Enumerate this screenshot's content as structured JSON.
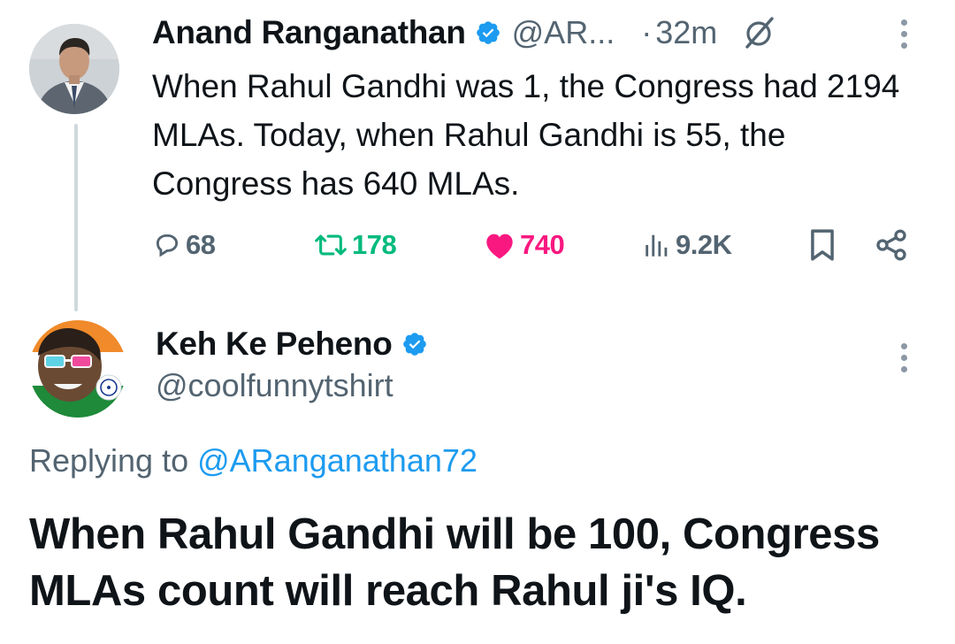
{
  "colors": {
    "text": "#0f1419",
    "secondary": "#536471",
    "verified": "#1d9bf0",
    "retweet": "#00ba7c",
    "like": "#f91880",
    "link": "#1d9bf0"
  },
  "parent_tweet": {
    "author_name": "Anand Ranganathan",
    "handle": "@AR...",
    "separator": "·",
    "time": "32m",
    "text": "When Rahul Gandhi was 1, the Congress had 2194 MLAs. Today, when Rahul Gandhi is 55, the Congress has 640 MLAs.",
    "icons": {
      "avatar": "avatar-photo",
      "verified": "verified-badge-icon",
      "grok": "grok-icon",
      "more": "more-options-icon"
    },
    "actions": {
      "replies": "68",
      "retweets": "178",
      "likes": "740",
      "views": "9.2K"
    }
  },
  "reply_tweet": {
    "author_name": "Keh Ke Peheno",
    "handle": "@coolfunnytshirt",
    "replying_prefix": "Replying to",
    "replying_to": "@ARanganathan72",
    "text": "When Rahul Gandhi will be 100, Congress MLAs count will reach Rahul ji's IQ.",
    "icons": {
      "avatar": "avatar-photo",
      "verified": "verified-badge-icon",
      "more": "more-options-icon"
    }
  }
}
